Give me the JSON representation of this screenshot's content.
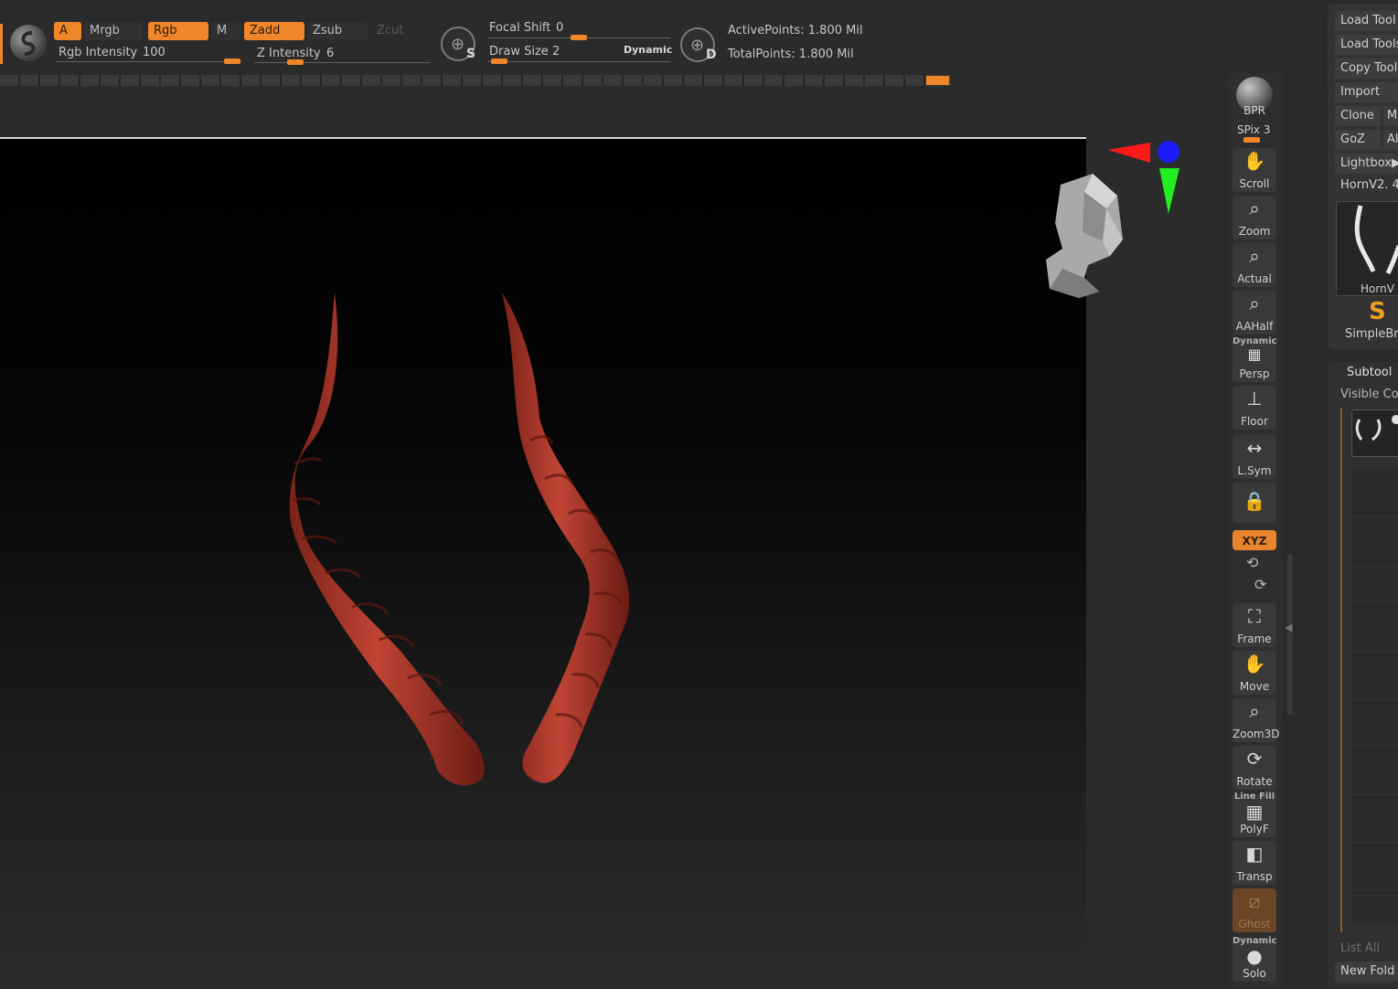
{
  "toolbar": {
    "a": "A",
    "mrgb": "Mrgb",
    "rgb": "Rgb",
    "m": "M",
    "zadd": "Zadd",
    "zsub": "Zsub",
    "zcut": "Zcut",
    "rgb_intensity_label": "Rgb Intensity",
    "rgb_intensity_value": "100",
    "z_intensity_label": "Z Intensity",
    "z_intensity_value": "6",
    "focal_shift_label": "Focal Shift",
    "focal_shift_value": "0",
    "draw_size_label": "Draw Size",
    "draw_size_value": "2",
    "dynamic": "Dynamic",
    "s_letter": "S",
    "d_letter": "D",
    "active_points": "ActivePoints: 1.800 Mil",
    "total_points": "TotalPoints: 1.800 Mil"
  },
  "shelf": {
    "bpr": "BPR",
    "spix_label": "SPix",
    "spix_value": "3",
    "scroll": "Scroll",
    "zoom": "Zoom",
    "actual": "Actual",
    "aahalf": "AAHalf",
    "persp": "Persp",
    "persp_top": "Dynamic",
    "floor": "Floor",
    "lsym": "L.Sym",
    "xyz": "XYZ",
    "frame": "Frame",
    "move": "Move",
    "zoom3d": "Zoom3D",
    "rotate": "Rotate",
    "polyf": "PolyF",
    "polyf_top": "Line Fill",
    "transp": "Transp",
    "ghost": "Ghost",
    "solo": "Solo",
    "solo_top": "Dynamic"
  },
  "panel": {
    "load_tool": "Load Tool",
    "load_tools": "Load Tools",
    "copy_tool": "Copy Tool",
    "import": "Import",
    "clone": "Clone",
    "clone_side": "M",
    "goz": "GoZ",
    "goz_side": "All",
    "lightbox": "Lightbox▶",
    "current_tool": "HornV2. 4",
    "thumb_label": "HornV",
    "simple_brush": "SimpleBr",
    "subtool_title": "Subtool",
    "visible_count": "Visible Co",
    "list_all": "List All",
    "new_folder": "New Fold"
  },
  "colors": {
    "accent": "#f0862a",
    "horn": "#b0382b",
    "gizmo_x": "#ff1a1a",
    "gizmo_y": "#22ee22",
    "gizmo_z": "#1a1aff"
  }
}
